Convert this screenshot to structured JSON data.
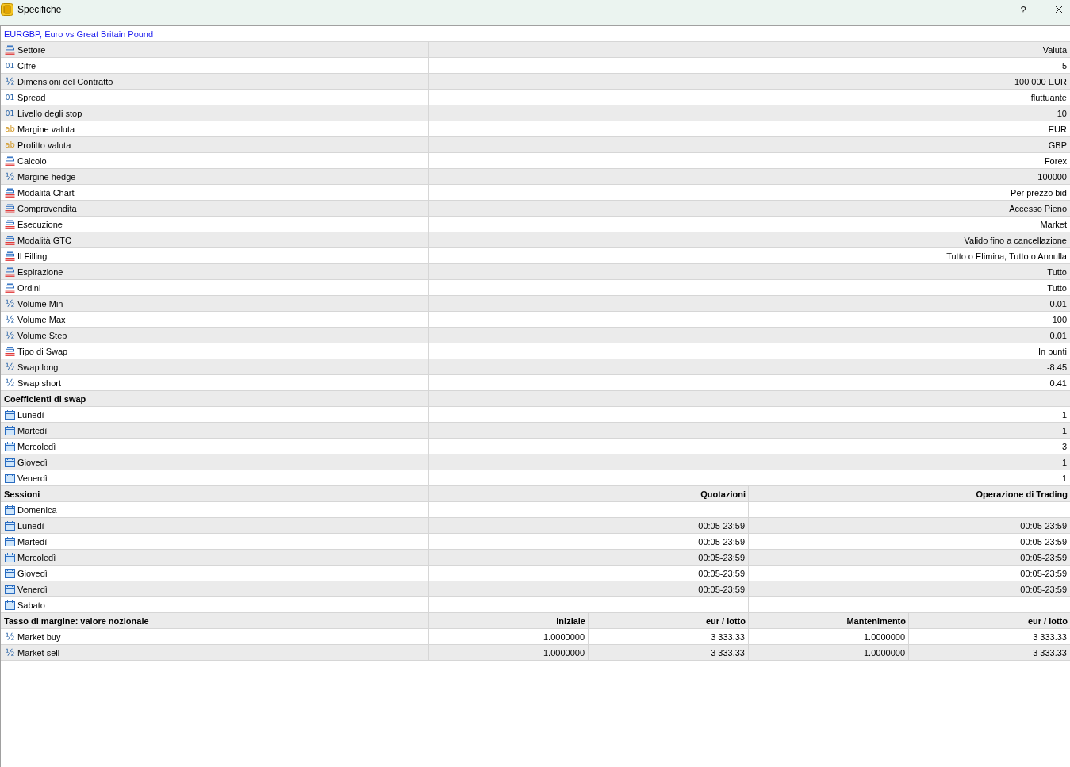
{
  "window": {
    "title": "Specifiche",
    "help": "?"
  },
  "symbol": "EURGBP, Euro vs Great Britain Pound",
  "properties": [
    {
      "kind": "enum",
      "label": "Settore",
      "value": "Valuta"
    },
    {
      "kind": "integer",
      "icon": "01",
      "label": "Cifre",
      "value": "5"
    },
    {
      "kind": "fraction",
      "icon": "½",
      "label": "Dimensioni del Contratto",
      "value": "100 000 EUR"
    },
    {
      "kind": "integer",
      "icon": "01",
      "label": "Spread",
      "value": "fluttuante"
    },
    {
      "kind": "integer",
      "icon": "01",
      "label": "Livello degli stop",
      "value": "10"
    },
    {
      "kind": "string",
      "icon": "ab",
      "label": "Margine valuta",
      "value": "EUR"
    },
    {
      "kind": "string",
      "icon": "ab",
      "label": "Profitto valuta",
      "value": "GBP"
    },
    {
      "kind": "enum",
      "label": "Calcolo",
      "value": "Forex"
    },
    {
      "kind": "fraction",
      "icon": "½",
      "label": "Margine hedge",
      "value": "100000"
    },
    {
      "kind": "enum",
      "label": "Modalità Chart",
      "value": "Per prezzo bid"
    },
    {
      "kind": "enum",
      "label": "Compravendita",
      "value": "Accesso Pieno"
    },
    {
      "kind": "enum",
      "label": "Esecuzione",
      "value": "Market"
    },
    {
      "kind": "enum",
      "label": "Modalità GTC",
      "value": "Valido fino a cancellazione"
    },
    {
      "kind": "enum",
      "label": "Il Filling",
      "value": "Tutto o Elimina, Tutto o Annulla"
    },
    {
      "kind": "enum",
      "label": "Espirazione",
      "value": "Tutto"
    },
    {
      "kind": "enum",
      "label": "Ordini",
      "value": "Tutto"
    },
    {
      "kind": "fraction",
      "icon": "½",
      "label": "Volume Min",
      "value": "0.01"
    },
    {
      "kind": "fraction",
      "icon": "½",
      "label": "Volume Max",
      "value": "100"
    },
    {
      "kind": "fraction",
      "icon": "½",
      "label": "Volume Step",
      "value": "0.01"
    },
    {
      "kind": "enum",
      "label": "Tipo di Swap",
      "value": "In punti"
    },
    {
      "kind": "fraction",
      "icon": "½",
      "label": "Swap long",
      "value": "-8.45"
    },
    {
      "kind": "fraction",
      "icon": "½",
      "label": "Swap short",
      "value": "0.41"
    }
  ],
  "swap_coefficients": {
    "title": "Coefficienti di swap",
    "rows": [
      {
        "day": "Lunedì",
        "value": "1"
      },
      {
        "day": "Martedì",
        "value": "1"
      },
      {
        "day": "Mercoledì",
        "value": "3"
      },
      {
        "day": "Giovedì",
        "value": "1"
      },
      {
        "day": "Venerdì",
        "value": "1"
      }
    ]
  },
  "sessions": {
    "title": "Sessioni",
    "columns": [
      "Quotazioni",
      "Operazione di Trading"
    ],
    "rows": [
      {
        "day": "Domenica"
      },
      {
        "day": "Lunedì",
        "quotes": "00:05-23:59",
        "trading": "00:05-23:59"
      },
      {
        "day": "Martedì",
        "quotes": "00:05-23:59",
        "trading": "00:05-23:59"
      },
      {
        "day": "Mercoledì",
        "quotes": "00:05-23:59",
        "trading": "00:05-23:59"
      },
      {
        "day": "Giovedì",
        "quotes": "00:05-23:59",
        "trading": "00:05-23:59"
      },
      {
        "day": "Venerdì",
        "quotes": "00:05-23:59",
        "trading": "00:05-23:59"
      },
      {
        "day": "Sabato"
      }
    ]
  },
  "margin_rates": {
    "title": "Tasso di margine: valore nozionale",
    "columns": [
      "Iniziale",
      "eur / lotto",
      "Mantenimento",
      "eur / lotto"
    ],
    "rows": [
      {
        "icon": "½",
        "label": "Market buy",
        "values": [
          "1.0000000",
          "3 333.33",
          "1.0000000",
          "3 333.33"
        ]
      },
      {
        "icon": "½",
        "label": "Market sell",
        "values": [
          "1.0000000",
          "3 333.33",
          "1.0000000",
          "3 333.33"
        ]
      }
    ]
  }
}
